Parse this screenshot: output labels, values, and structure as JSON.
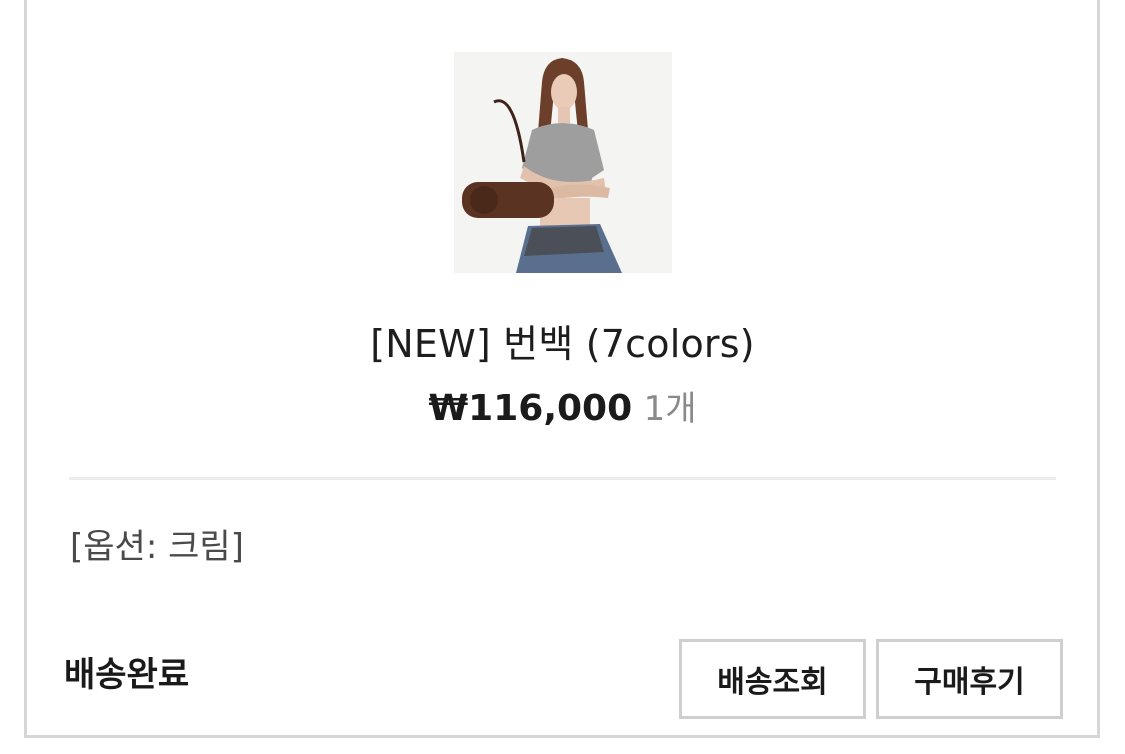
{
  "product": {
    "image_icon": "product-photo",
    "title": "[NEW] 번백 (7colors)",
    "price": "₩116,000",
    "quantity": "1개",
    "option": "[옵션: 크림]"
  },
  "order": {
    "status": "배송완료",
    "track_label": "배송조회",
    "review_label": "구매후기"
  }
}
